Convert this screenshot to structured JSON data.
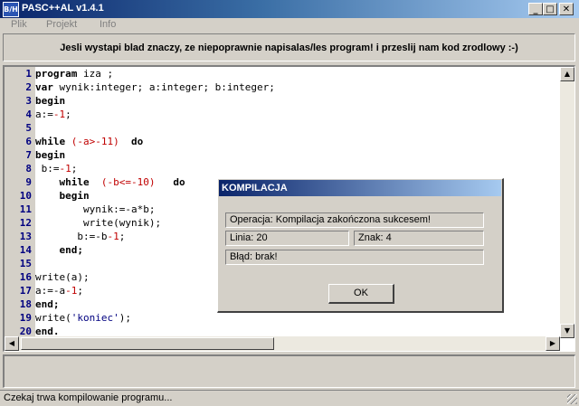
{
  "window": {
    "title": "PASC++AL v1.4.1",
    "icon_label": "B/H",
    "minimize_glyph": "_",
    "maximize_glyph": "□",
    "close_glyph": "✕"
  },
  "menu": [
    {
      "label": "Plik"
    },
    {
      "label": "Projekt"
    },
    {
      "label": "Info"
    }
  ],
  "banner": {
    "text": "Jesli wystapi blad znaczy, ze niepoprawnie napisalas/les program! i przeslij nam kod zrodlowy :-)"
  },
  "editor": {
    "lines": [
      {
        "num": "1",
        "tokens": [
          {
            "t": "program",
            "c": "kw"
          },
          {
            "t": " iza ;",
            "c": ""
          }
        ]
      },
      {
        "num": "2",
        "tokens": [
          {
            "t": "var",
            "c": "kw"
          },
          {
            "t": " wynik:integer; a:integer; b:integer;",
            "c": ""
          }
        ]
      },
      {
        "num": "3",
        "tokens": [
          {
            "t": "begin",
            "c": "kw"
          }
        ]
      },
      {
        "num": "4",
        "tokens": [
          {
            "t": "a:=",
            "c": ""
          },
          {
            "t": "-1",
            "c": "num"
          },
          {
            "t": ";",
            "c": ""
          }
        ]
      },
      {
        "num": "5",
        "tokens": []
      },
      {
        "num": "6",
        "tokens": [
          {
            "t": "while",
            "c": "kw"
          },
          {
            "t": " ",
            "c": ""
          },
          {
            "t": "(-a>-11)",
            "c": "num"
          },
          {
            "t": "  ",
            "c": ""
          },
          {
            "t": "do",
            "c": "kw"
          }
        ]
      },
      {
        "num": "7",
        "tokens": [
          {
            "t": "begin",
            "c": "kw"
          }
        ]
      },
      {
        "num": "8",
        "tokens": [
          {
            "t": " b:=",
            "c": ""
          },
          {
            "t": "-1",
            "c": "num"
          },
          {
            "t": ";",
            "c": ""
          }
        ]
      },
      {
        "num": "9",
        "tokens": [
          {
            "t": "    ",
            "c": ""
          },
          {
            "t": "while",
            "c": "kw"
          },
          {
            "t": "  ",
            "c": ""
          },
          {
            "t": "(-b<=-10)",
            "c": "num"
          },
          {
            "t": "   ",
            "c": ""
          },
          {
            "t": "do",
            "c": "kw"
          }
        ]
      },
      {
        "num": "10",
        "tokens": [
          {
            "t": "    ",
            "c": ""
          },
          {
            "t": "begin",
            "c": "kw"
          }
        ]
      },
      {
        "num": "11",
        "tokens": [
          {
            "t": "        wynik:=-a*b;",
            "c": ""
          }
        ]
      },
      {
        "num": "12",
        "tokens": [
          {
            "t": "        write(wynik);",
            "c": ""
          }
        ]
      },
      {
        "num": "13",
        "tokens": [
          {
            "t": "       b:=-b",
            "c": ""
          },
          {
            "t": "-1",
            "c": "num"
          },
          {
            "t": ";",
            "c": ""
          }
        ]
      },
      {
        "num": "14",
        "tokens": [
          {
            "t": "    ",
            "c": ""
          },
          {
            "t": "end;",
            "c": "kw"
          }
        ]
      },
      {
        "num": "15",
        "tokens": []
      },
      {
        "num": "16",
        "tokens": [
          {
            "t": "write(a);",
            "c": ""
          }
        ]
      },
      {
        "num": "17",
        "tokens": [
          {
            "t": "a:=-a",
            "c": ""
          },
          {
            "t": "-1",
            "c": "num"
          },
          {
            "t": ";",
            "c": ""
          }
        ]
      },
      {
        "num": "18",
        "tokens": [
          {
            "t": "end;",
            "c": "kw"
          }
        ]
      },
      {
        "num": "19",
        "tokens": [
          {
            "t": "write(",
            "c": ""
          },
          {
            "t": "'koniec'",
            "c": "str"
          },
          {
            "t": ");",
            "c": ""
          }
        ]
      },
      {
        "num": "20",
        "tokens": [
          {
            "t": "end.",
            "c": "kw"
          }
        ]
      }
    ]
  },
  "scroll": {
    "up": "▲",
    "down": "▼",
    "left": "◀",
    "right": "▶"
  },
  "dialog": {
    "title": "KOMPILACJA",
    "operation": "Operacja: Kompilacja zakończona sukcesem!",
    "line": "Linia: 20",
    "char": "Znak: 4",
    "error": "Błąd: brak!",
    "ok_label": "OK"
  },
  "status": {
    "text": "Czekaj trwa kompilowanie programu..."
  },
  "colors": {
    "keyword": "#000000",
    "number": "#c00000",
    "string": "#000080",
    "line_number": "#000080",
    "title_gradient_start": "#0a246a"
  }
}
